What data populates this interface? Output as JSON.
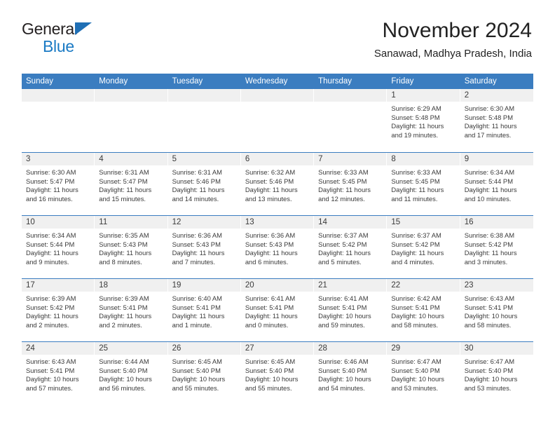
{
  "logo": {
    "line1": "General",
    "line2": "Blue",
    "triangle_color": "#1f6fb5",
    "blue_text_color": "#1a7ac4"
  },
  "header": {
    "title": "November 2024",
    "subtitle": "Sanawad, Madhya Pradesh, India"
  },
  "theme": {
    "header_blue": "#3b7dc0",
    "day_band_grey": "#f0f0f0",
    "text_color": "#3a3a3a"
  },
  "weekday_headers": [
    "Sunday",
    "Monday",
    "Tuesday",
    "Wednesday",
    "Thursday",
    "Friday",
    "Saturday"
  ],
  "weeks": [
    [
      {
        "day": "",
        "sunrise": "",
        "sunset": "",
        "daylight1": "",
        "daylight2": ""
      },
      {
        "day": "",
        "sunrise": "",
        "sunset": "",
        "daylight1": "",
        "daylight2": ""
      },
      {
        "day": "",
        "sunrise": "",
        "sunset": "",
        "daylight1": "",
        "daylight2": ""
      },
      {
        "day": "",
        "sunrise": "",
        "sunset": "",
        "daylight1": "",
        "daylight2": ""
      },
      {
        "day": "",
        "sunrise": "",
        "sunset": "",
        "daylight1": "",
        "daylight2": ""
      },
      {
        "day": "1",
        "sunrise": "Sunrise: 6:29 AM",
        "sunset": "Sunset: 5:48 PM",
        "daylight1": "Daylight: 11 hours",
        "daylight2": "and 19 minutes."
      },
      {
        "day": "2",
        "sunrise": "Sunrise: 6:30 AM",
        "sunset": "Sunset: 5:48 PM",
        "daylight1": "Daylight: 11 hours",
        "daylight2": "and 17 minutes."
      }
    ],
    [
      {
        "day": "3",
        "sunrise": "Sunrise: 6:30 AM",
        "sunset": "Sunset: 5:47 PM",
        "daylight1": "Daylight: 11 hours",
        "daylight2": "and 16 minutes."
      },
      {
        "day": "4",
        "sunrise": "Sunrise: 6:31 AM",
        "sunset": "Sunset: 5:47 PM",
        "daylight1": "Daylight: 11 hours",
        "daylight2": "and 15 minutes."
      },
      {
        "day": "5",
        "sunrise": "Sunrise: 6:31 AM",
        "sunset": "Sunset: 5:46 PM",
        "daylight1": "Daylight: 11 hours",
        "daylight2": "and 14 minutes."
      },
      {
        "day": "6",
        "sunrise": "Sunrise: 6:32 AM",
        "sunset": "Sunset: 5:46 PM",
        "daylight1": "Daylight: 11 hours",
        "daylight2": "and 13 minutes."
      },
      {
        "day": "7",
        "sunrise": "Sunrise: 6:33 AM",
        "sunset": "Sunset: 5:45 PM",
        "daylight1": "Daylight: 11 hours",
        "daylight2": "and 12 minutes."
      },
      {
        "day": "8",
        "sunrise": "Sunrise: 6:33 AM",
        "sunset": "Sunset: 5:45 PM",
        "daylight1": "Daylight: 11 hours",
        "daylight2": "and 11 minutes."
      },
      {
        "day": "9",
        "sunrise": "Sunrise: 6:34 AM",
        "sunset": "Sunset: 5:44 PM",
        "daylight1": "Daylight: 11 hours",
        "daylight2": "and 10 minutes."
      }
    ],
    [
      {
        "day": "10",
        "sunrise": "Sunrise: 6:34 AM",
        "sunset": "Sunset: 5:44 PM",
        "daylight1": "Daylight: 11 hours",
        "daylight2": "and 9 minutes."
      },
      {
        "day": "11",
        "sunrise": "Sunrise: 6:35 AM",
        "sunset": "Sunset: 5:43 PM",
        "daylight1": "Daylight: 11 hours",
        "daylight2": "and 8 minutes."
      },
      {
        "day": "12",
        "sunrise": "Sunrise: 6:36 AM",
        "sunset": "Sunset: 5:43 PM",
        "daylight1": "Daylight: 11 hours",
        "daylight2": "and 7 minutes."
      },
      {
        "day": "13",
        "sunrise": "Sunrise: 6:36 AM",
        "sunset": "Sunset: 5:43 PM",
        "daylight1": "Daylight: 11 hours",
        "daylight2": "and 6 minutes."
      },
      {
        "day": "14",
        "sunrise": "Sunrise: 6:37 AM",
        "sunset": "Sunset: 5:42 PM",
        "daylight1": "Daylight: 11 hours",
        "daylight2": "and 5 minutes."
      },
      {
        "day": "15",
        "sunrise": "Sunrise: 6:37 AM",
        "sunset": "Sunset: 5:42 PM",
        "daylight1": "Daylight: 11 hours",
        "daylight2": "and 4 minutes."
      },
      {
        "day": "16",
        "sunrise": "Sunrise: 6:38 AM",
        "sunset": "Sunset: 5:42 PM",
        "daylight1": "Daylight: 11 hours",
        "daylight2": "and 3 minutes."
      }
    ],
    [
      {
        "day": "17",
        "sunrise": "Sunrise: 6:39 AM",
        "sunset": "Sunset: 5:42 PM",
        "daylight1": "Daylight: 11 hours",
        "daylight2": "and 2 minutes."
      },
      {
        "day": "18",
        "sunrise": "Sunrise: 6:39 AM",
        "sunset": "Sunset: 5:41 PM",
        "daylight1": "Daylight: 11 hours",
        "daylight2": "and 2 minutes."
      },
      {
        "day": "19",
        "sunrise": "Sunrise: 6:40 AM",
        "sunset": "Sunset: 5:41 PM",
        "daylight1": "Daylight: 11 hours",
        "daylight2": "and 1 minute."
      },
      {
        "day": "20",
        "sunrise": "Sunrise: 6:41 AM",
        "sunset": "Sunset: 5:41 PM",
        "daylight1": "Daylight: 11 hours",
        "daylight2": "and 0 minutes."
      },
      {
        "day": "21",
        "sunrise": "Sunrise: 6:41 AM",
        "sunset": "Sunset: 5:41 PM",
        "daylight1": "Daylight: 10 hours",
        "daylight2": "and 59 minutes."
      },
      {
        "day": "22",
        "sunrise": "Sunrise: 6:42 AM",
        "sunset": "Sunset: 5:41 PM",
        "daylight1": "Daylight: 10 hours",
        "daylight2": "and 58 minutes."
      },
      {
        "day": "23",
        "sunrise": "Sunrise: 6:43 AM",
        "sunset": "Sunset: 5:41 PM",
        "daylight1": "Daylight: 10 hours",
        "daylight2": "and 58 minutes."
      }
    ],
    [
      {
        "day": "24",
        "sunrise": "Sunrise: 6:43 AM",
        "sunset": "Sunset: 5:41 PM",
        "daylight1": "Daylight: 10 hours",
        "daylight2": "and 57 minutes."
      },
      {
        "day": "25",
        "sunrise": "Sunrise: 6:44 AM",
        "sunset": "Sunset: 5:40 PM",
        "daylight1": "Daylight: 10 hours",
        "daylight2": "and 56 minutes."
      },
      {
        "day": "26",
        "sunrise": "Sunrise: 6:45 AM",
        "sunset": "Sunset: 5:40 PM",
        "daylight1": "Daylight: 10 hours",
        "daylight2": "and 55 minutes."
      },
      {
        "day": "27",
        "sunrise": "Sunrise: 6:45 AM",
        "sunset": "Sunset: 5:40 PM",
        "daylight1": "Daylight: 10 hours",
        "daylight2": "and 55 minutes."
      },
      {
        "day": "28",
        "sunrise": "Sunrise: 6:46 AM",
        "sunset": "Sunset: 5:40 PM",
        "daylight1": "Daylight: 10 hours",
        "daylight2": "and 54 minutes."
      },
      {
        "day": "29",
        "sunrise": "Sunrise: 6:47 AM",
        "sunset": "Sunset: 5:40 PM",
        "daylight1": "Daylight: 10 hours",
        "daylight2": "and 53 minutes."
      },
      {
        "day": "30",
        "sunrise": "Sunrise: 6:47 AM",
        "sunset": "Sunset: 5:40 PM",
        "daylight1": "Daylight: 10 hours",
        "daylight2": "and 53 minutes."
      }
    ]
  ]
}
